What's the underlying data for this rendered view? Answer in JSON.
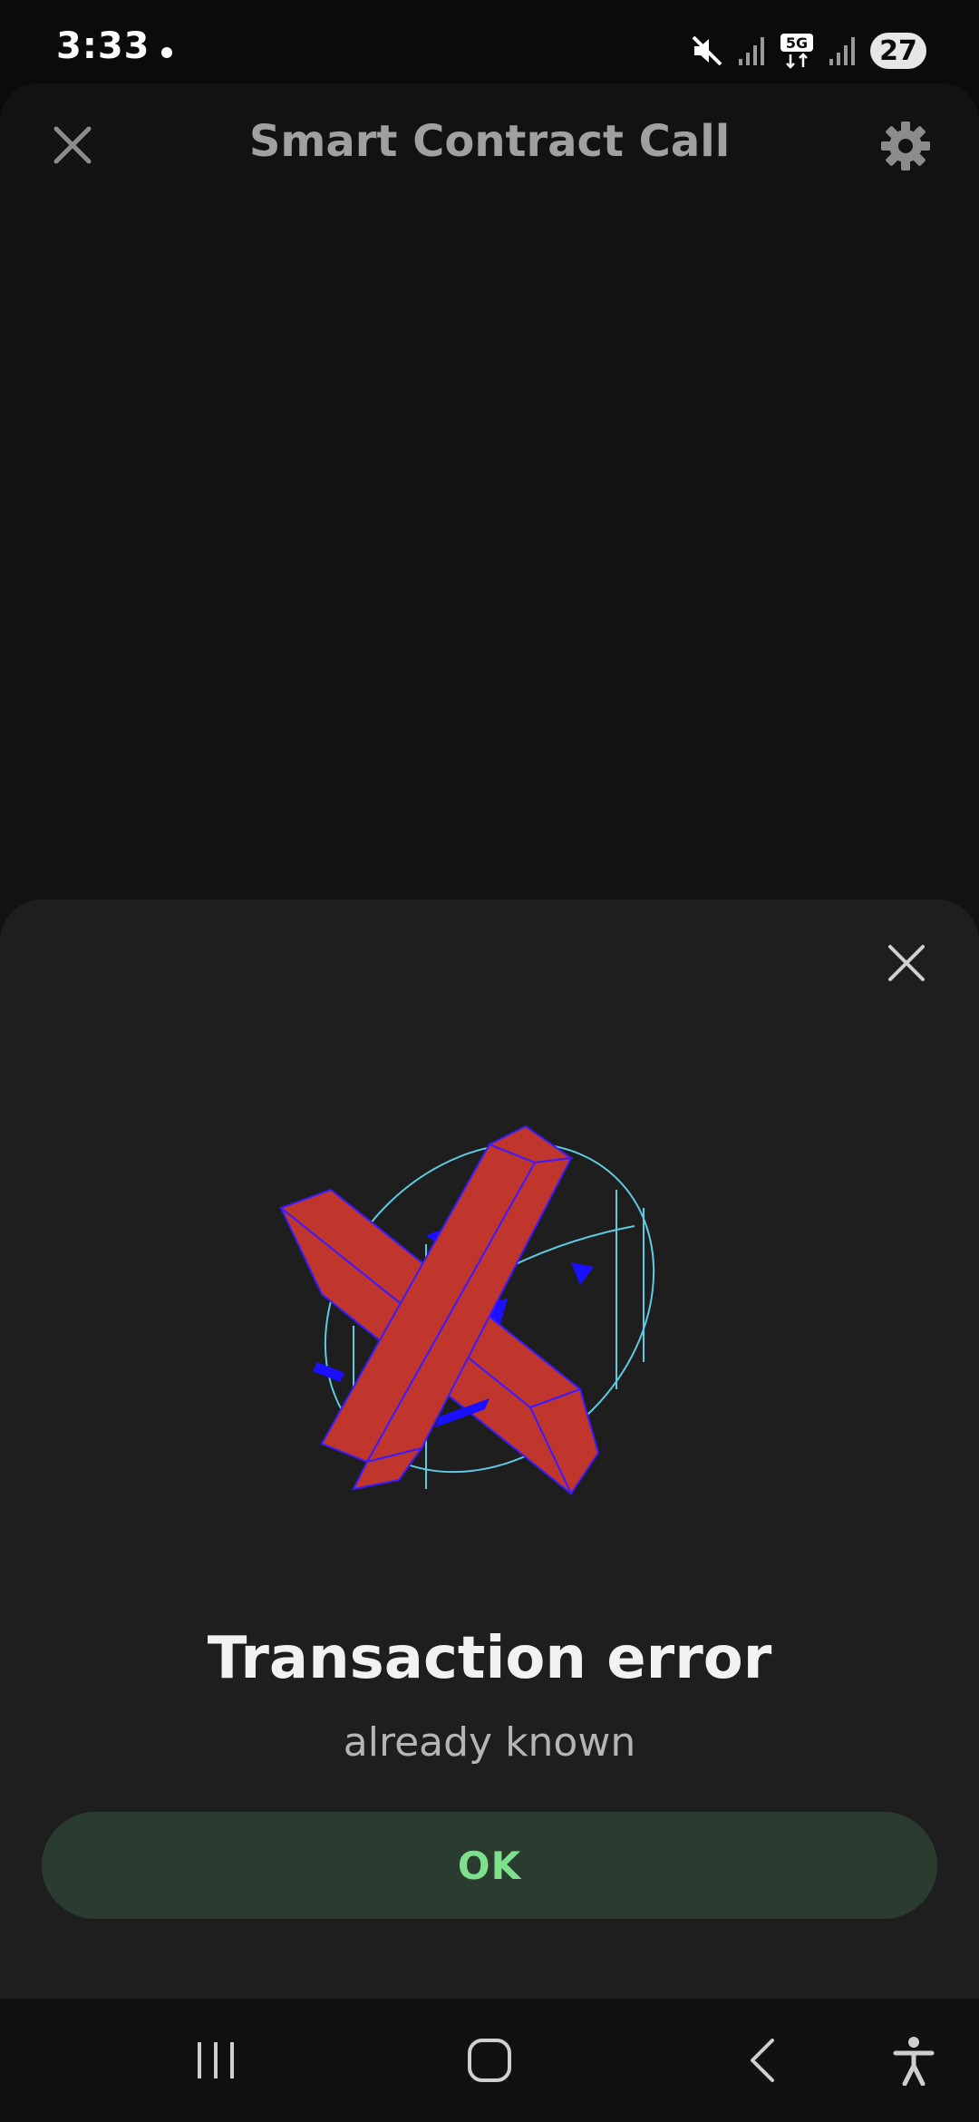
{
  "status_bar": {
    "time": "3:33",
    "battery": "27",
    "network": "5G",
    "icons": [
      "notification-dot",
      "mute-icon",
      "signal-icon",
      "5g-icon",
      "signal-icon",
      "battery-icon"
    ]
  },
  "header": {
    "title": "Smart Contract Call",
    "close_icon": "close-icon",
    "settings_icon": "gear-icon"
  },
  "dialog": {
    "close_icon": "close-icon",
    "illustration": "error-x-illustration",
    "title": "Transaction error",
    "message": "already known",
    "ok_label": "OK"
  },
  "nav_bar": {
    "items": [
      "recent-apps-icon",
      "home-icon",
      "back-icon",
      "accessibility-icon"
    ]
  },
  "colors": {
    "sheet_background": "#1e1e1f",
    "app_background": "#121212",
    "ok_button_bg": "#2a3b2f",
    "ok_button_text": "#7ee08c",
    "x_red": "#c0352c",
    "x_accent_blue": "#1a10ff",
    "ellipse_cyan": "#5ec9e0"
  }
}
